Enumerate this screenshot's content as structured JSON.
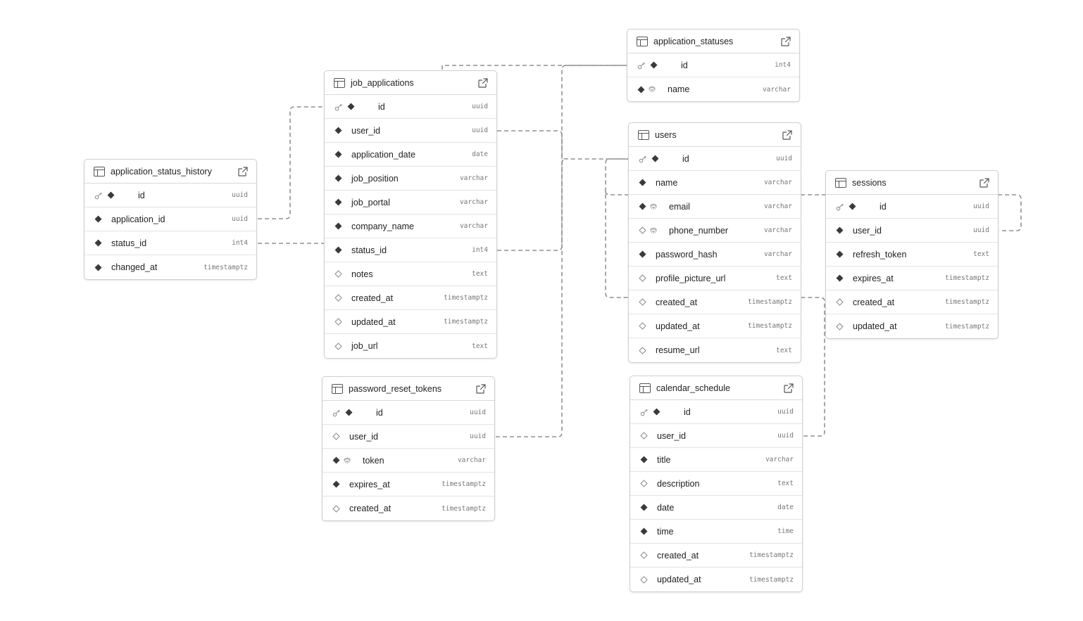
{
  "colors": {
    "border": "#cfcfcf",
    "link": "#7a7a7a",
    "icon": "#555555",
    "type_text": "#777777"
  },
  "icons": {
    "table": "table-icon",
    "open": "external-link-icon",
    "primary_key": "key-icon",
    "not_null": "filled-diamond-icon",
    "nullable": "hollow-diamond-icon",
    "unique": "fingerprint-icon"
  },
  "tables": [
    {
      "id": "application_status_history",
      "name": "application_status_history",
      "columns": [
        {
          "name": "id",
          "type": "uuid",
          "pk": true,
          "nullable": false
        },
        {
          "name": "application_id",
          "type": "uuid",
          "nullable": false
        },
        {
          "name": "status_id",
          "type": "int4",
          "nullable": false
        },
        {
          "name": "changed_at",
          "type": "timestamptz",
          "nullable": false
        }
      ]
    },
    {
      "id": "job_applications",
      "name": "job_applications",
      "columns": [
        {
          "name": "id",
          "type": "uuid",
          "pk": true,
          "nullable": false
        },
        {
          "name": "user_id",
          "type": "uuid",
          "nullable": false
        },
        {
          "name": "application_date",
          "type": "date",
          "nullable": false
        },
        {
          "name": "job_position",
          "type": "varchar",
          "nullable": false
        },
        {
          "name": "job_portal",
          "type": "varchar",
          "nullable": false
        },
        {
          "name": "company_name",
          "type": "varchar",
          "nullable": false
        },
        {
          "name": "status_id",
          "type": "int4",
          "nullable": false
        },
        {
          "name": "notes",
          "type": "text",
          "nullable": true
        },
        {
          "name": "created_at",
          "type": "timestamptz",
          "nullable": true
        },
        {
          "name": "updated_at",
          "type": "timestamptz",
          "nullable": true
        },
        {
          "name": "job_url",
          "type": "text",
          "nullable": true
        }
      ]
    },
    {
      "id": "password_reset_tokens",
      "name": "password_reset_tokens",
      "columns": [
        {
          "name": "id",
          "type": "uuid",
          "pk": true,
          "nullable": false
        },
        {
          "name": "user_id",
          "type": "uuid",
          "nullable": true
        },
        {
          "name": "token",
          "type": "varchar",
          "nullable": false,
          "unique": true
        },
        {
          "name": "expires_at",
          "type": "timestamptz",
          "nullable": false
        },
        {
          "name": "created_at",
          "type": "timestamptz",
          "nullable": true
        }
      ]
    },
    {
      "id": "application_statuses",
      "name": "application_statuses",
      "columns": [
        {
          "name": "id",
          "type": "int4",
          "pk": true,
          "nullable": false
        },
        {
          "name": "name",
          "type": "varchar",
          "nullable": false,
          "unique": true
        }
      ]
    },
    {
      "id": "users",
      "name": "users",
      "columns": [
        {
          "name": "id",
          "type": "uuid",
          "pk": true,
          "nullable": false
        },
        {
          "name": "name",
          "type": "varchar",
          "nullable": false
        },
        {
          "name": "email",
          "type": "varchar",
          "nullable": false,
          "unique": true
        },
        {
          "name": "phone_number",
          "type": "varchar",
          "nullable": true,
          "unique": true
        },
        {
          "name": "password_hash",
          "type": "varchar",
          "nullable": false
        },
        {
          "name": "profile_picture_url",
          "type": "text",
          "nullable": true
        },
        {
          "name": "created_at",
          "type": "timestamptz",
          "nullable": true
        },
        {
          "name": "updated_at",
          "type": "timestamptz",
          "nullable": true
        },
        {
          "name": "resume_url",
          "type": "text",
          "nullable": true
        }
      ]
    },
    {
      "id": "calendar_schedule",
      "name": "calendar_schedule",
      "columns": [
        {
          "name": "id",
          "type": "uuid",
          "pk": true,
          "nullable": false
        },
        {
          "name": "user_id",
          "type": "uuid",
          "nullable": true
        },
        {
          "name": "title",
          "type": "varchar",
          "nullable": false
        },
        {
          "name": "description",
          "type": "text",
          "nullable": true
        },
        {
          "name": "date",
          "type": "date",
          "nullable": false
        },
        {
          "name": "time",
          "type": "time",
          "nullable": false
        },
        {
          "name": "created_at",
          "type": "timestamptz",
          "nullable": true
        },
        {
          "name": "updated_at",
          "type": "timestamptz",
          "nullable": true
        }
      ]
    },
    {
      "id": "sessions",
      "name": "sessions",
      "columns": [
        {
          "name": "id",
          "type": "uuid",
          "pk": true,
          "nullable": false
        },
        {
          "name": "user_id",
          "type": "uuid",
          "nullable": false
        },
        {
          "name": "refresh_token",
          "type": "text",
          "nullable": false
        },
        {
          "name": "expires_at",
          "type": "timestamptz",
          "nullable": false
        },
        {
          "name": "created_at",
          "type": "timestamptz",
          "nullable": true
        },
        {
          "name": "updated_at",
          "type": "timestamptz",
          "nullable": true
        }
      ]
    }
  ],
  "relationships": [
    {
      "from": "application_status_history.application_id",
      "to": "job_applications.id"
    },
    {
      "from": "application_status_history.status_id",
      "to": "job_applications.status_id"
    },
    {
      "from": "job_applications.status_id",
      "to": "application_statuses.id"
    },
    {
      "from": "job_applications.user_id",
      "to": "users.id"
    },
    {
      "from": "password_reset_tokens.user_id",
      "to": "users.id"
    },
    {
      "from": "calendar_schedule.user_id",
      "to": "users.id"
    },
    {
      "from": "sessions.user_id",
      "to": "users.id"
    },
    {
      "from": "users.created_at",
      "to": "users.id"
    }
  ]
}
